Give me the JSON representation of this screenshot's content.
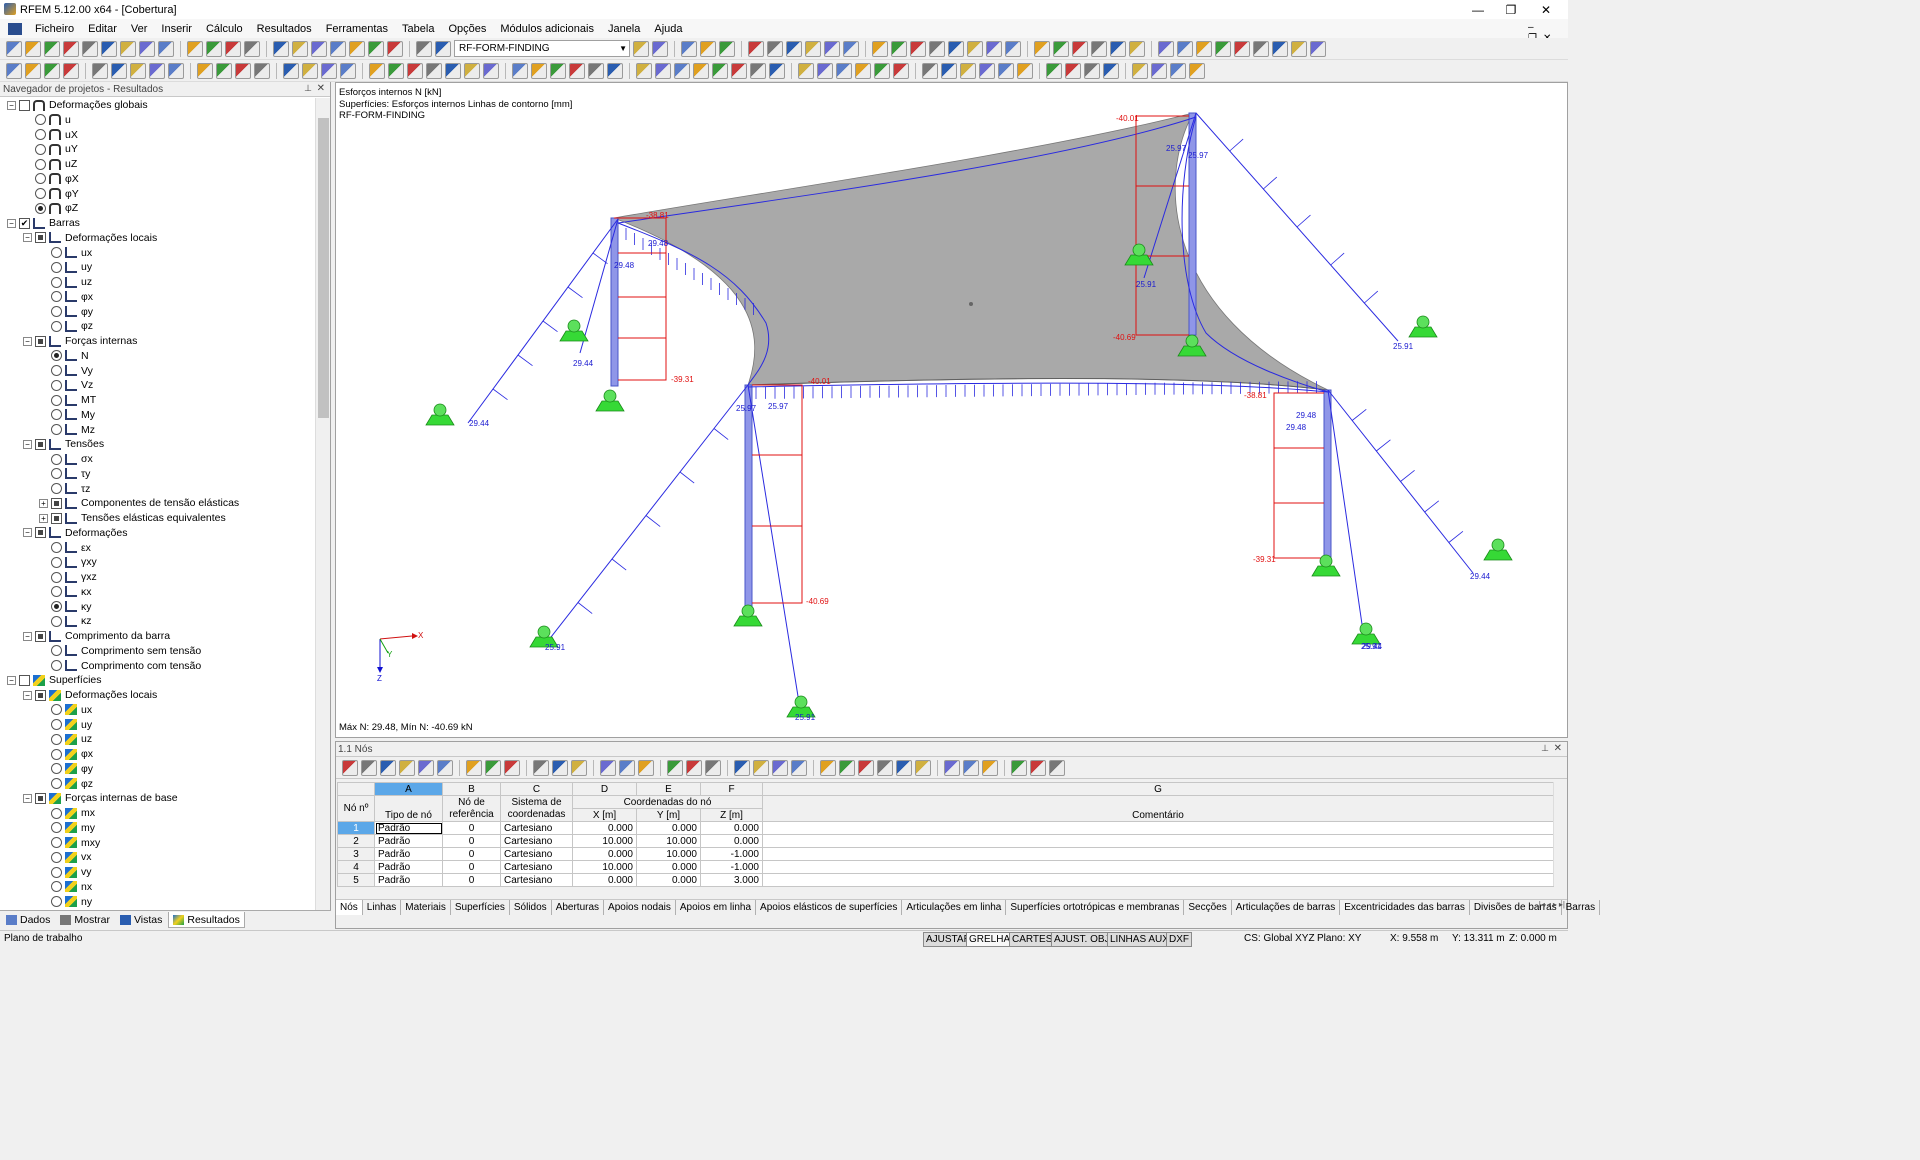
{
  "app": {
    "title": "RFEM 5.12.00 x64 - [Cobertura]"
  },
  "menu": [
    "Ficheiro",
    "Editar",
    "Ver",
    "Inserir",
    "Cálculo",
    "Resultados",
    "Ferramentas",
    "Tabela",
    "Opções",
    "Módulos adicionais",
    "Janela",
    "Ajuda"
  ],
  "toolbar": {
    "load_case": "RF-FORM-FINDING"
  },
  "navigator": {
    "title": "Navegador de projetos - Resultados",
    "tree": [
      {
        "label": "Deformações globais",
        "level": 0,
        "exp": "-",
        "ctl": "chk",
        "icon": "def"
      },
      {
        "label": "u",
        "level": 1,
        "ctl": "rad",
        "icon": "def"
      },
      {
        "label": "uX",
        "level": 1,
        "ctl": "rad",
        "icon": "def"
      },
      {
        "label": "uY",
        "level": 1,
        "ctl": "rad",
        "icon": "def"
      },
      {
        "label": "uZ",
        "level": 1,
        "ctl": "rad",
        "icon": "def"
      },
      {
        "label": "φX",
        "level": 1,
        "ctl": "rad",
        "icon": "def"
      },
      {
        "label": "φY",
        "level": 1,
        "ctl": "rad",
        "icon": "def"
      },
      {
        "label": "φZ",
        "level": 1,
        "ctl": "rad",
        "icon": "def",
        "on": true
      },
      {
        "label": "Barras",
        "level": 0,
        "exp": "-",
        "ctl": "chk",
        "icon": "bar",
        "checked": true
      },
      {
        "label": "Deformações locais",
        "level": 1,
        "exp": "-",
        "ctl": "chk",
        "icon": "bar",
        "partial": true
      },
      {
        "label": "ux",
        "level": 2,
        "ctl": "rad",
        "icon": "bar"
      },
      {
        "label": "uy",
        "level": 2,
        "ctl": "rad",
        "icon": "bar"
      },
      {
        "label": "uz",
        "level": 2,
        "ctl": "rad",
        "icon": "bar"
      },
      {
        "label": "φx",
        "level": 2,
        "ctl": "rad",
        "icon": "bar"
      },
      {
        "label": "φy",
        "level": 2,
        "ctl": "rad",
        "icon": "bar"
      },
      {
        "label": "φz",
        "level": 2,
        "ctl": "rad",
        "icon": "bar"
      },
      {
        "label": "Forças internas",
        "level": 1,
        "exp": "-",
        "ctl": "chk",
        "icon": "bar",
        "partial": true
      },
      {
        "label": "N",
        "level": 2,
        "ctl": "rad",
        "icon": "bar",
        "on": true
      },
      {
        "label": "Vy",
        "level": 2,
        "ctl": "rad",
        "icon": "bar"
      },
      {
        "label": "Vz",
        "level": 2,
        "ctl": "rad",
        "icon": "bar"
      },
      {
        "label": "MT",
        "level": 2,
        "ctl": "rad",
        "icon": "bar"
      },
      {
        "label": "My",
        "level": 2,
        "ctl": "rad",
        "icon": "bar"
      },
      {
        "label": "Mz",
        "level": 2,
        "ctl": "rad",
        "icon": "bar"
      },
      {
        "label": "Tensões",
        "level": 1,
        "exp": "-",
        "ctl": "chk",
        "icon": "bar",
        "partial": true
      },
      {
        "label": "σx",
        "level": 2,
        "ctl": "rad",
        "icon": "bar"
      },
      {
        "label": "τy",
        "level": 2,
        "ctl": "rad",
        "icon": "bar"
      },
      {
        "label": "τz",
        "level": 2,
        "ctl": "rad",
        "icon": "bar"
      },
      {
        "label": "Componentes de tensão elásticas",
        "level": 2,
        "exp": "+",
        "ctl": "chk",
        "icon": "bar",
        "partial": true
      },
      {
        "label": "Tensões elásticas equivalentes",
        "level": 2,
        "exp": "+",
        "ctl": "chk",
        "icon": "bar",
        "partial": true
      },
      {
        "label": "Deformações",
        "level": 1,
        "exp": "-",
        "ctl": "chk",
        "icon": "bar",
        "partial": true
      },
      {
        "label": "εx",
        "level": 2,
        "ctl": "rad",
        "icon": "bar"
      },
      {
        "label": "γxy",
        "level": 2,
        "ctl": "rad",
        "icon": "bar"
      },
      {
        "label": "γxz",
        "level": 2,
        "ctl": "rad",
        "icon": "bar"
      },
      {
        "label": "κx",
        "level": 2,
        "ctl": "rad",
        "icon": "bar"
      },
      {
        "label": "κy",
        "level": 2,
        "ctl": "rad",
        "icon": "bar",
        "on": true
      },
      {
        "label": "κz",
        "level": 2,
        "ctl": "rad",
        "icon": "bar"
      },
      {
        "label": "Comprimento da barra",
        "level": 1,
        "exp": "-",
        "ctl": "chk",
        "icon": "bar",
        "partial": true
      },
      {
        "label": "Comprimento sem tensão",
        "level": 2,
        "ctl": "rad",
        "icon": "bar"
      },
      {
        "label": "Comprimento com tensão",
        "level": 2,
        "ctl": "rad",
        "icon": "bar"
      },
      {
        "label": "Superfícies",
        "level": 0,
        "exp": "-",
        "ctl": "chk",
        "icon": "surf"
      },
      {
        "label": "Deformações locais",
        "level": 1,
        "exp": "-",
        "ctl": "chk",
        "icon": "surf",
        "partial": true
      },
      {
        "label": "ux",
        "level": 2,
        "ctl": "rad",
        "icon": "surf"
      },
      {
        "label": "uy",
        "level": 2,
        "ctl": "rad",
        "icon": "surf"
      },
      {
        "label": "uz",
        "level": 2,
        "ctl": "rad",
        "icon": "surf"
      },
      {
        "label": "φx",
        "level": 2,
        "ctl": "rad",
        "icon": "surf"
      },
      {
        "label": "φy",
        "level": 2,
        "ctl": "rad",
        "icon": "surf"
      },
      {
        "label": "φz",
        "level": 2,
        "ctl": "rad",
        "icon": "surf"
      },
      {
        "label": "Forças internas de base",
        "level": 1,
        "exp": "-",
        "ctl": "chk",
        "icon": "surf",
        "partial": true
      },
      {
        "label": "mx",
        "level": 2,
        "ctl": "rad",
        "icon": "surf"
      },
      {
        "label": "my",
        "level": 2,
        "ctl": "rad",
        "icon": "surf"
      },
      {
        "label": "mxy",
        "level": 2,
        "ctl": "rad",
        "icon": "surf"
      },
      {
        "label": "vx",
        "level": 2,
        "ctl": "rad",
        "icon": "surf"
      },
      {
        "label": "vy",
        "level": 2,
        "ctl": "rad",
        "icon": "surf"
      },
      {
        "label": "nx",
        "level": 2,
        "ctl": "rad",
        "icon": "surf"
      },
      {
        "label": "ny",
        "level": 2,
        "ctl": "rad",
        "icon": "surf"
      }
    ],
    "tabs": [
      "Dados",
      "Mostrar",
      "Vistas",
      "Resultados"
    ]
  },
  "view": {
    "info": [
      "Esforços internos N [kN]",
      "Superfícies: Esforços internos Linhas de contorno [mm]",
      "RF-FORM-FINDING"
    ],
    "footer": "Máx N: 29.48, Mín N: -40.69 kN",
    "axis": {
      "x": "X",
      "y": "Y",
      "z": "Z"
    },
    "labels_red": [
      "-40.01",
      "-38.81",
      "-39.31",
      "-40.69",
      "-40.01",
      "-38.81",
      "-39.31",
      "-40.69"
    ],
    "labels_blue": [
      "25.97",
      "25.97",
      "29.48",
      "29.48",
      "25.91",
      "29.44",
      "29.44",
      "25.97",
      "25.97",
      "29.48",
      "29.48",
      "25.91",
      "29.44",
      "25.91",
      "25.91",
      "25.91",
      "29.44"
    ]
  },
  "table": {
    "title": "1.1 Nós",
    "col_letters": [
      "A",
      "B",
      "C",
      "D",
      "E",
      "F",
      "G"
    ],
    "head": {
      "no": "Nó nº",
      "tipo": "Tipo de nó",
      "ref": "Nó de referência",
      "sist": "Sistema de coordenadas",
      "coord": "Coordenadas do nó",
      "x": "X [m]",
      "y": "Y [m]",
      "z": "Z [m]",
      "com": "Comentário"
    },
    "rows": [
      {
        "n": "1",
        "tipo": "Padrão",
        "ref": "0",
        "sist": "Cartesiano",
        "x": "0.000",
        "y": "0.000",
        "z": "0.000"
      },
      {
        "n": "2",
        "tipo": "Padrão",
        "ref": "0",
        "sist": "Cartesiano",
        "x": "10.000",
        "y": "10.000",
        "z": "0.000"
      },
      {
        "n": "3",
        "tipo": "Padrão",
        "ref": "0",
        "sist": "Cartesiano",
        "x": "0.000",
        "y": "10.000",
        "z": "-1.000"
      },
      {
        "n": "4",
        "tipo": "Padrão",
        "ref": "0",
        "sist": "Cartesiano",
        "x": "10.000",
        "y": "0.000",
        "z": "-1.000"
      },
      {
        "n": "5",
        "tipo": "Padrão",
        "ref": "0",
        "sist": "Cartesiano",
        "x": "0.000",
        "y": "0.000",
        "z": "3.000"
      }
    ],
    "tabs": [
      "Nós",
      "Linhas",
      "Materiais",
      "Superfícies",
      "Sólidos",
      "Aberturas",
      "Apoios nodais",
      "Apoios em linha",
      "Apoios elásticos de superfícies",
      "Articulações em linha",
      "Superfícies ortotrópicas e membranas",
      "Secções",
      "Articulações de barras",
      "Excentricidades das barras",
      "Divisões de barras",
      "Barras"
    ]
  },
  "status": {
    "left": "Plano de trabalho",
    "buttons": [
      "AJUSTAR",
      "GRELHA",
      "CARTES",
      "AJUST. OBJ.",
      "LINHAS AUX.",
      "DXF"
    ],
    "cs": "CS: Global XYZ",
    "plane": "Plano: XY",
    "x": "X:  9.558 m",
    "y": "Y:  13.311 m",
    "z": "Z:  0.000 m"
  }
}
